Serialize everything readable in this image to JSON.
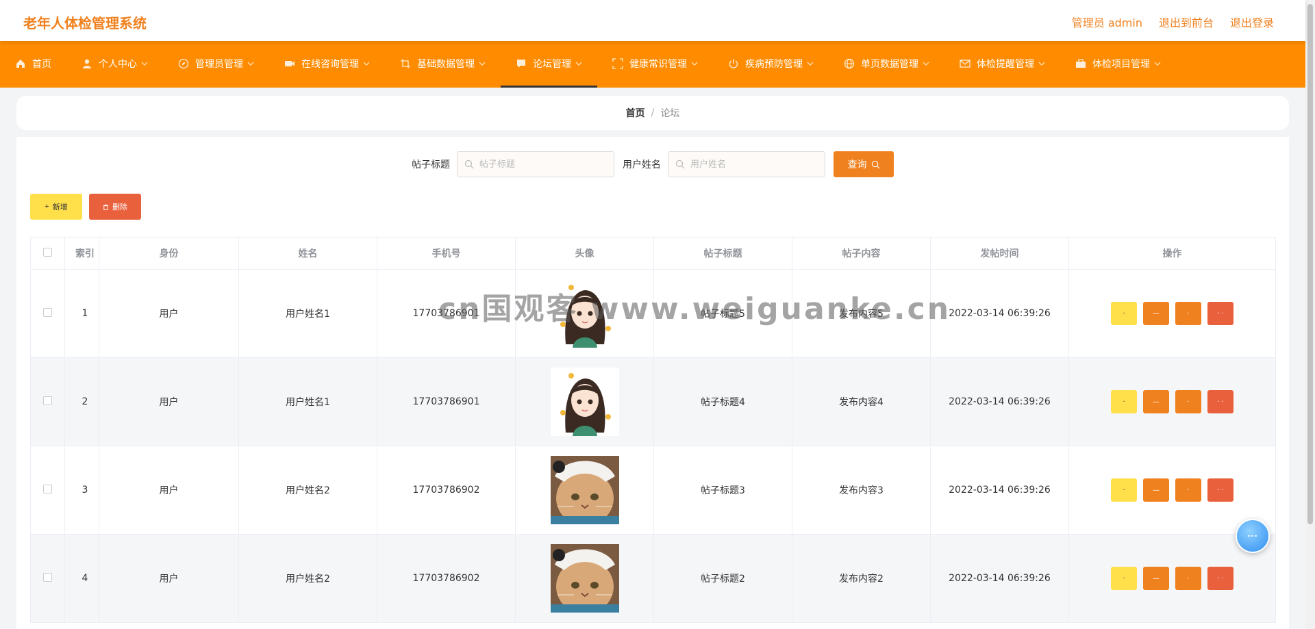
{
  "header": {
    "app_title": "老年人体检管理系统",
    "admin_label": "管理员 admin",
    "front_link": "退出到前台",
    "logout_link": "退出登录"
  },
  "nav": {
    "items": [
      {
        "label": "首页",
        "icon": "home-icon"
      },
      {
        "label": "个人中心",
        "icon": "user-icon"
      },
      {
        "label": "管理员管理",
        "icon": "compass-icon"
      },
      {
        "label": "在线咨询管理",
        "icon": "video-icon"
      },
      {
        "label": "基础数据管理",
        "icon": "crop-icon"
      },
      {
        "label": "论坛管理",
        "icon": "chat-icon"
      },
      {
        "label": "健康常识管理",
        "icon": "fullscreen-icon"
      },
      {
        "label": "疾病预防管理",
        "icon": "power-icon"
      },
      {
        "label": "单页数据管理",
        "icon": "globe-icon"
      },
      {
        "label": "体检提醒管理",
        "icon": "mail-icon"
      },
      {
        "label": "体检项目管理",
        "icon": "briefcase-icon"
      }
    ],
    "active_index": 5
  },
  "breadcrumb": {
    "home": "首页",
    "separator": "/",
    "current": "论坛"
  },
  "search": {
    "title_label": "帖子标题",
    "title_placeholder": "帖子标题",
    "user_label": "用户姓名",
    "user_placeholder": "用户姓名",
    "button_label": "查询"
  },
  "actions": {
    "add_label": "新增",
    "delete_label": "删除"
  },
  "table": {
    "headers": [
      "索引",
      "身份",
      "姓名",
      "手机号",
      "头像",
      "帖子标题",
      "帖子内容",
      "发帖时间",
      "操作"
    ],
    "rows": [
      {
        "index": "1",
        "identity": "用户",
        "name": "用户姓名1",
        "phone": "17703786901",
        "avatar": "girl-avatar",
        "title": "帖子标题5",
        "content": "发布内容5",
        "time": "2022-03-14 06:39:26"
      },
      {
        "index": "2",
        "identity": "用户",
        "name": "用户姓名1",
        "phone": "17703786901",
        "avatar": "girl-avatar",
        "title": "帖子标题4",
        "content": "发布内容4",
        "time": "2022-03-14 06:39:26"
      },
      {
        "index": "3",
        "identity": "用户",
        "name": "用户姓名2",
        "phone": "17703786902",
        "avatar": "cat-avatar",
        "title": "帖子标题3",
        "content": "发布内容3",
        "time": "2022-03-14 06:39:26"
      },
      {
        "index": "4",
        "identity": "用户",
        "name": "用户姓名2",
        "phone": "17703786902",
        "avatar": "cat-avatar",
        "title": "帖子标题2",
        "content": "发布内容2",
        "time": "2022-03-14 06:39:26"
      }
    ]
  },
  "watermark": "cn国观客 www.weiguanke.cn",
  "colors": {
    "brand": "#f0811f",
    "nav_bg": "#ff8c00",
    "yellow": "#ffe04b",
    "red": "#e8603c"
  }
}
